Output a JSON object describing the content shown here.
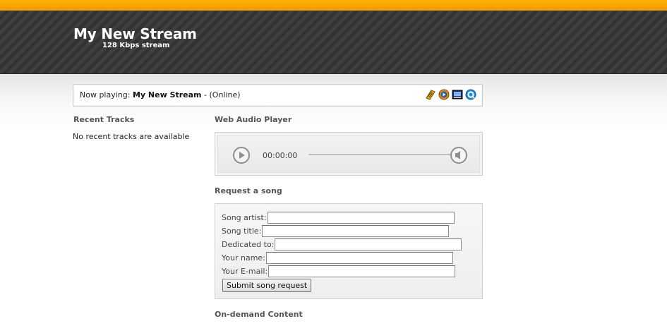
{
  "header": {
    "title": "My New Stream",
    "subtitle": "128 Kbps stream"
  },
  "now_playing": {
    "prefix": "Now playing:",
    "stream_name": "My New Stream",
    "status": "- (Online)",
    "icons": [
      "winamp-icon",
      "windows-media-player-icon",
      "realplayer-icon",
      "quicktime-icon"
    ]
  },
  "recent_tracks": {
    "title": "Recent Tracks",
    "empty_message": "No recent tracks are available"
  },
  "web_player": {
    "title": "Web Audio Player",
    "time": "00:00:00",
    "progress": 0
  },
  "request_song": {
    "title": "Request a song",
    "fields": {
      "artist": {
        "label": "Song artist:",
        "value": ""
      },
      "song_title": {
        "label": "Song title:",
        "value": ""
      },
      "dedicated_to": {
        "label": "Dedicated to:",
        "value": ""
      },
      "your_name": {
        "label": "Your name:",
        "value": ""
      },
      "your_email": {
        "label": "Your E-mail:",
        "value": ""
      }
    },
    "submit_label": "Submit song request"
  },
  "on_demand": {
    "title": "On-demand Content"
  },
  "colors": {
    "accent_stripe": "#f7a200",
    "header_bg": "#3a3a3a",
    "header_text": "#ffffff"
  }
}
